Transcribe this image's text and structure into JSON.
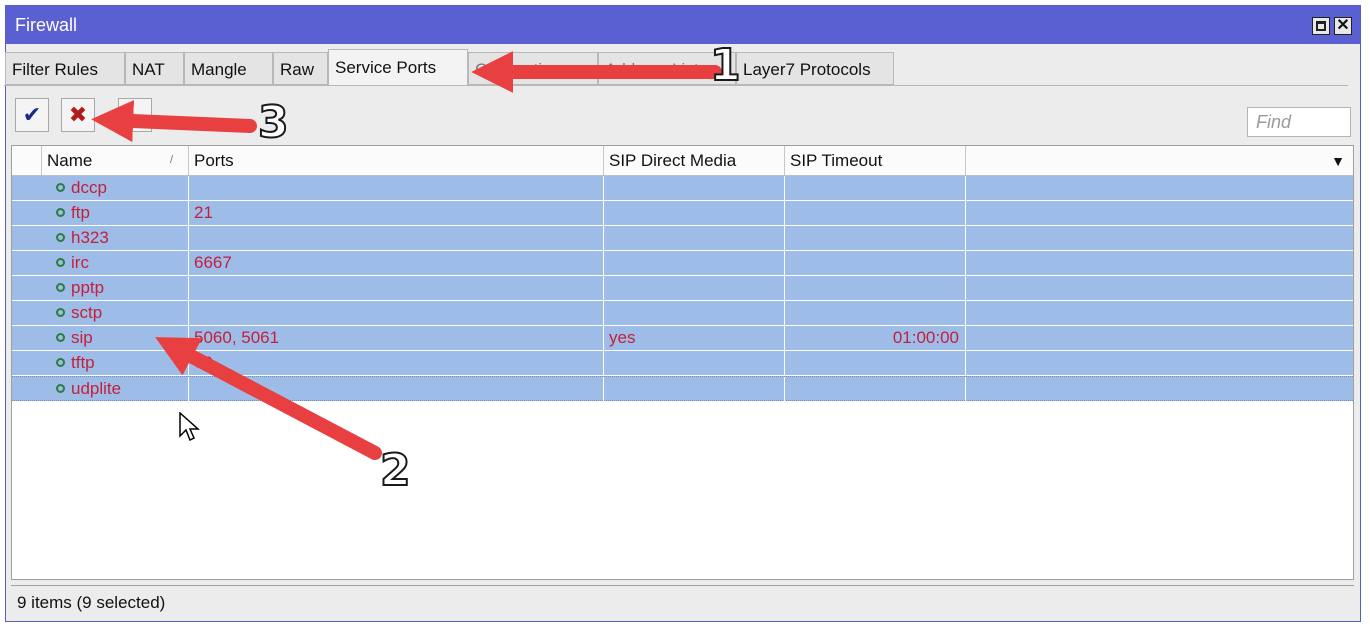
{
  "window": {
    "title": "Firewall",
    "close_label": "✕"
  },
  "tabs": [
    {
      "label": "Filter Rules",
      "active": false
    },
    {
      "label": "NAT",
      "active": false
    },
    {
      "label": "Mangle",
      "active": false
    },
    {
      "label": "Raw",
      "active": false
    },
    {
      "label": "Service Ports",
      "active": true
    },
    {
      "label": "Connections",
      "active": false
    },
    {
      "label": "Address Lists",
      "active": false
    },
    {
      "label": "Layer7 Protocols",
      "active": false
    }
  ],
  "toolbar": {
    "enable_icon": "checkmark-icon",
    "disable_icon": "x-icon",
    "find_placeholder": "Find"
  },
  "columns": {
    "name": "Name",
    "ports": "Ports",
    "sip_direct_media": "SIP Direct Media",
    "sip_timeout": "SIP Timeout"
  },
  "rows": [
    {
      "name": "dccp",
      "ports": "",
      "sip_direct_media": "",
      "sip_timeout": ""
    },
    {
      "name": "ftp",
      "ports": "21",
      "sip_direct_media": "",
      "sip_timeout": ""
    },
    {
      "name": "h323",
      "ports": "",
      "sip_direct_media": "",
      "sip_timeout": ""
    },
    {
      "name": "irc",
      "ports": "6667",
      "sip_direct_media": "",
      "sip_timeout": ""
    },
    {
      "name": "pptp",
      "ports": "",
      "sip_direct_media": "",
      "sip_timeout": ""
    },
    {
      "name": "sctp",
      "ports": "",
      "sip_direct_media": "",
      "sip_timeout": ""
    },
    {
      "name": "sip",
      "ports": "5060, 5061",
      "sip_direct_media": "yes",
      "sip_timeout": "01:00:00"
    },
    {
      "name": "tftp",
      "ports": "69",
      "sip_direct_media": "",
      "sip_timeout": ""
    },
    {
      "name": "udplite",
      "ports": "",
      "sip_direct_media": "",
      "sip_timeout": ""
    }
  ],
  "status": "9 items (9 selected)",
  "annotations": {
    "one": "1",
    "two": "2",
    "three": "3"
  },
  "colors": {
    "selection": "#9dbde8",
    "text_red": "#c4203b",
    "arrow": "#e84040",
    "title_bar": "#5a5fd2"
  }
}
